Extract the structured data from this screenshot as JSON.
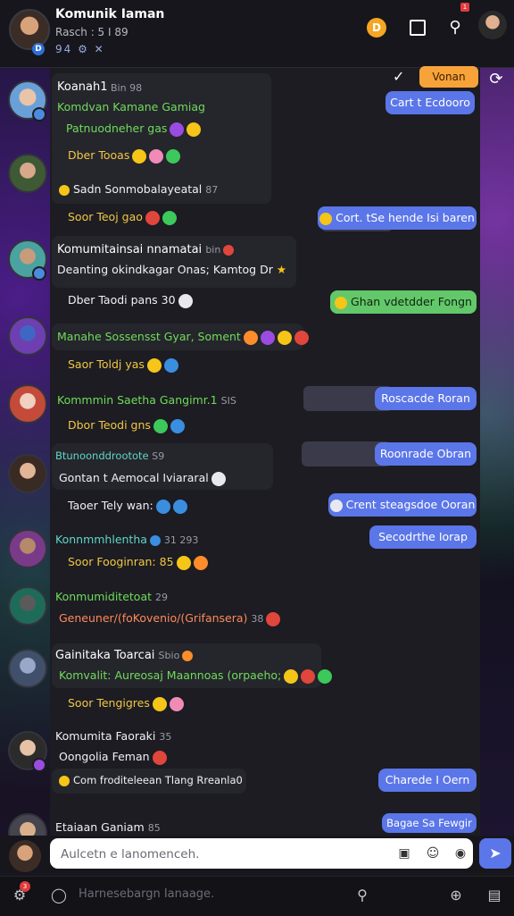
{
  "header": {
    "title": "Komunik Iaman",
    "subtitle": "Rasch : 5 I 89",
    "icon_row": "94 ⚙ ✕",
    "badge": "D",
    "coin": "D",
    "notification_count": "1"
  },
  "top_actions": {
    "orange_button": "Vonan"
  },
  "messages": [
    {
      "name": "Koanah1",
      "meta": "Bin 98",
      "lines": [
        "Komdvan Kamane Gamiag",
        "Patnuodneher gas",
        "Dber Tooas"
      ]
    },
    {
      "name": "",
      "meta": "",
      "lines": [
        "Sadn Sonmobalayeatal",
        "Soor Teoj gao"
      ],
      "line1_meta": "87"
    },
    {
      "name": "Komumitainsai nnamatai",
      "meta": "bin",
      "lines": [
        "Deanting okindkagar Onas; Kamtog Dr"
      ]
    },
    {
      "name": "",
      "meta": "",
      "lines": [
        "Dber Taodi pans 30"
      ]
    },
    {
      "name": "",
      "meta": "",
      "lines": [
        "Manahe Sossensst Gyar, Soment",
        "Saor Toldj yas"
      ]
    },
    {
      "name": "Kommmin Saetha Gangimr.1",
      "meta": "SIS",
      "lines": [
        "Dbor Teodi gns"
      ]
    },
    {
      "name": "Btunoonddrootote",
      "meta": "S9",
      "lines": [
        "Gontan t Aemocal Iviararal",
        "Taoer Tely wan:"
      ]
    },
    {
      "name": "Konnmmhlentha",
      "meta": "31 293",
      "lines": [
        "Soor Fooginran: 85"
      ]
    },
    {
      "name": "Konmumiditetoat",
      "meta": "29",
      "lines": [
        "Geneuner/(foKovenio/(Grifansera)",
        "38"
      ]
    },
    {
      "name": "Gainitaka Toarcai",
      "meta": "Sbio",
      "lines": [
        "Komvalit: Aureosaj Maannoas (orpaeho;",
        "Soor Tengigres"
      ]
    },
    {
      "name": "Komumita Faoraki",
      "meta": "35",
      "lines": [
        "Oongolia Feman",
        "Com froditeleean Tlang Rreanla0"
      ]
    },
    {
      "name": "Etaiaan Ganiam",
      "meta": "85",
      "lines": []
    }
  ],
  "right_bubbles": [
    "Cart t Ecdooro",
    "Cort. tSe hende Isi baren",
    "Ghan vdetdder Fongn",
    "Roscacde Roran",
    "Roonrade Obran",
    "Crent steagsdoe Ooran",
    "Secodrthe Iorap",
    "Charede I Oern",
    "Bagae Sa Fewgir"
  ],
  "composer": {
    "placeholder": "Aulcetn e lanomenceh."
  },
  "bottom_bar": {
    "placeholder": "Harnesebargn Ianaage.",
    "badge": "3"
  }
}
